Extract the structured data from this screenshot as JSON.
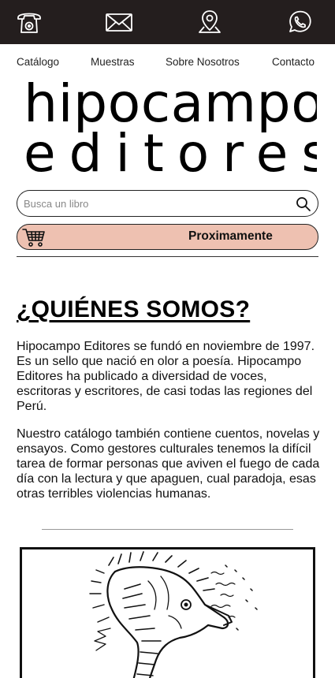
{
  "topbar": {
    "icons": [
      "phone-icon",
      "mail-icon",
      "location-pin-icon",
      "whatsapp-icon"
    ]
  },
  "nav": {
    "items": [
      "Catálogo",
      "Muestras",
      "Sobre Nosotros",
      "Contacto"
    ]
  },
  "logo": {
    "line1": "hipocampo",
    "line2": "editores"
  },
  "search": {
    "placeholder": "Busca un libro"
  },
  "promo": {
    "label": "Proximamente"
  },
  "about": {
    "title": "¿QUIÉNES SOMOS?",
    "paragraph1": "Hipocampo Editores se fundó en noviembre de 1997. Es un sello que nació en olor a poesía. Hipocampo Editores ha publicado a diversidad de voces, escritoras y escritores, de casi todas las regiones del Perú.",
    "paragraph2": "Nuestro catálogo también contiene cuentos, novelas y ensayos. Como gestores culturales tenemos la difícil tarea de formar personas que aviven el fuego de cada día con la lectura y que apaguen, cual paradoja, esas otras terribles violencias humanas."
  },
  "colors": {
    "topbar_bg": "#241e1e",
    "promo_bg": "#eec1b1",
    "icon_stroke": "#ffffff"
  }
}
